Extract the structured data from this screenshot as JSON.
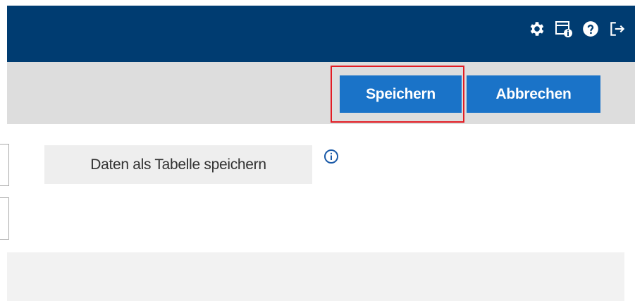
{
  "topbar": {
    "background": "#003c71",
    "icons": [
      {
        "name": "gear-icon",
        "label": "settings"
      },
      {
        "name": "info-window-icon",
        "label": "info"
      },
      {
        "name": "help-icon",
        "label": "help"
      },
      {
        "name": "logout-icon",
        "label": "logout"
      }
    ]
  },
  "toolbar": {
    "save_label": "Speichern",
    "cancel_label": "Abbrechen",
    "button_color": "#1a73c8",
    "highlight_color": "#e31b23"
  },
  "content": {
    "table_save_label": "Daten als Tabelle speichern",
    "info_icon": "info-circle-icon"
  }
}
